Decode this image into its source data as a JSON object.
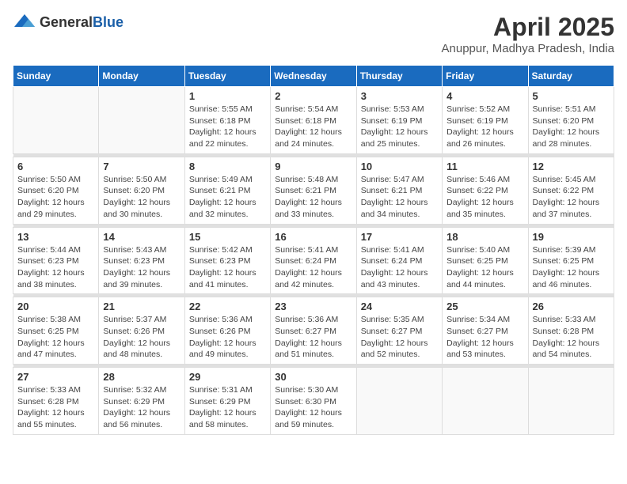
{
  "logo": {
    "general": "General",
    "blue": "Blue"
  },
  "title": "April 2025",
  "subtitle": "Anuppur, Madhya Pradesh, India",
  "days_of_week": [
    "Sunday",
    "Monday",
    "Tuesday",
    "Wednesday",
    "Thursday",
    "Friday",
    "Saturday"
  ],
  "weeks": [
    [
      {
        "day": "",
        "info": ""
      },
      {
        "day": "",
        "info": ""
      },
      {
        "day": "1",
        "info": "Sunrise: 5:55 AM\nSunset: 6:18 PM\nDaylight: 12 hours and 22 minutes."
      },
      {
        "day": "2",
        "info": "Sunrise: 5:54 AM\nSunset: 6:18 PM\nDaylight: 12 hours and 24 minutes."
      },
      {
        "day": "3",
        "info": "Sunrise: 5:53 AM\nSunset: 6:19 PM\nDaylight: 12 hours and 25 minutes."
      },
      {
        "day": "4",
        "info": "Sunrise: 5:52 AM\nSunset: 6:19 PM\nDaylight: 12 hours and 26 minutes."
      },
      {
        "day": "5",
        "info": "Sunrise: 5:51 AM\nSunset: 6:20 PM\nDaylight: 12 hours and 28 minutes."
      }
    ],
    [
      {
        "day": "6",
        "info": "Sunrise: 5:50 AM\nSunset: 6:20 PM\nDaylight: 12 hours and 29 minutes."
      },
      {
        "day": "7",
        "info": "Sunrise: 5:50 AM\nSunset: 6:20 PM\nDaylight: 12 hours and 30 minutes."
      },
      {
        "day": "8",
        "info": "Sunrise: 5:49 AM\nSunset: 6:21 PM\nDaylight: 12 hours and 32 minutes."
      },
      {
        "day": "9",
        "info": "Sunrise: 5:48 AM\nSunset: 6:21 PM\nDaylight: 12 hours and 33 minutes."
      },
      {
        "day": "10",
        "info": "Sunrise: 5:47 AM\nSunset: 6:21 PM\nDaylight: 12 hours and 34 minutes."
      },
      {
        "day": "11",
        "info": "Sunrise: 5:46 AM\nSunset: 6:22 PM\nDaylight: 12 hours and 35 minutes."
      },
      {
        "day": "12",
        "info": "Sunrise: 5:45 AM\nSunset: 6:22 PM\nDaylight: 12 hours and 37 minutes."
      }
    ],
    [
      {
        "day": "13",
        "info": "Sunrise: 5:44 AM\nSunset: 6:23 PM\nDaylight: 12 hours and 38 minutes."
      },
      {
        "day": "14",
        "info": "Sunrise: 5:43 AM\nSunset: 6:23 PM\nDaylight: 12 hours and 39 minutes."
      },
      {
        "day": "15",
        "info": "Sunrise: 5:42 AM\nSunset: 6:23 PM\nDaylight: 12 hours and 41 minutes."
      },
      {
        "day": "16",
        "info": "Sunrise: 5:41 AM\nSunset: 6:24 PM\nDaylight: 12 hours and 42 minutes."
      },
      {
        "day": "17",
        "info": "Sunrise: 5:41 AM\nSunset: 6:24 PM\nDaylight: 12 hours and 43 minutes."
      },
      {
        "day": "18",
        "info": "Sunrise: 5:40 AM\nSunset: 6:25 PM\nDaylight: 12 hours and 44 minutes."
      },
      {
        "day": "19",
        "info": "Sunrise: 5:39 AM\nSunset: 6:25 PM\nDaylight: 12 hours and 46 minutes."
      }
    ],
    [
      {
        "day": "20",
        "info": "Sunrise: 5:38 AM\nSunset: 6:25 PM\nDaylight: 12 hours and 47 minutes."
      },
      {
        "day": "21",
        "info": "Sunrise: 5:37 AM\nSunset: 6:26 PM\nDaylight: 12 hours and 48 minutes."
      },
      {
        "day": "22",
        "info": "Sunrise: 5:36 AM\nSunset: 6:26 PM\nDaylight: 12 hours and 49 minutes."
      },
      {
        "day": "23",
        "info": "Sunrise: 5:36 AM\nSunset: 6:27 PM\nDaylight: 12 hours and 51 minutes."
      },
      {
        "day": "24",
        "info": "Sunrise: 5:35 AM\nSunset: 6:27 PM\nDaylight: 12 hours and 52 minutes."
      },
      {
        "day": "25",
        "info": "Sunrise: 5:34 AM\nSunset: 6:27 PM\nDaylight: 12 hours and 53 minutes."
      },
      {
        "day": "26",
        "info": "Sunrise: 5:33 AM\nSunset: 6:28 PM\nDaylight: 12 hours and 54 minutes."
      }
    ],
    [
      {
        "day": "27",
        "info": "Sunrise: 5:33 AM\nSunset: 6:28 PM\nDaylight: 12 hours and 55 minutes."
      },
      {
        "day": "28",
        "info": "Sunrise: 5:32 AM\nSunset: 6:29 PM\nDaylight: 12 hours and 56 minutes."
      },
      {
        "day": "29",
        "info": "Sunrise: 5:31 AM\nSunset: 6:29 PM\nDaylight: 12 hours and 58 minutes."
      },
      {
        "day": "30",
        "info": "Sunrise: 5:30 AM\nSunset: 6:30 PM\nDaylight: 12 hours and 59 minutes."
      },
      {
        "day": "",
        "info": ""
      },
      {
        "day": "",
        "info": ""
      },
      {
        "day": "",
        "info": ""
      }
    ]
  ]
}
